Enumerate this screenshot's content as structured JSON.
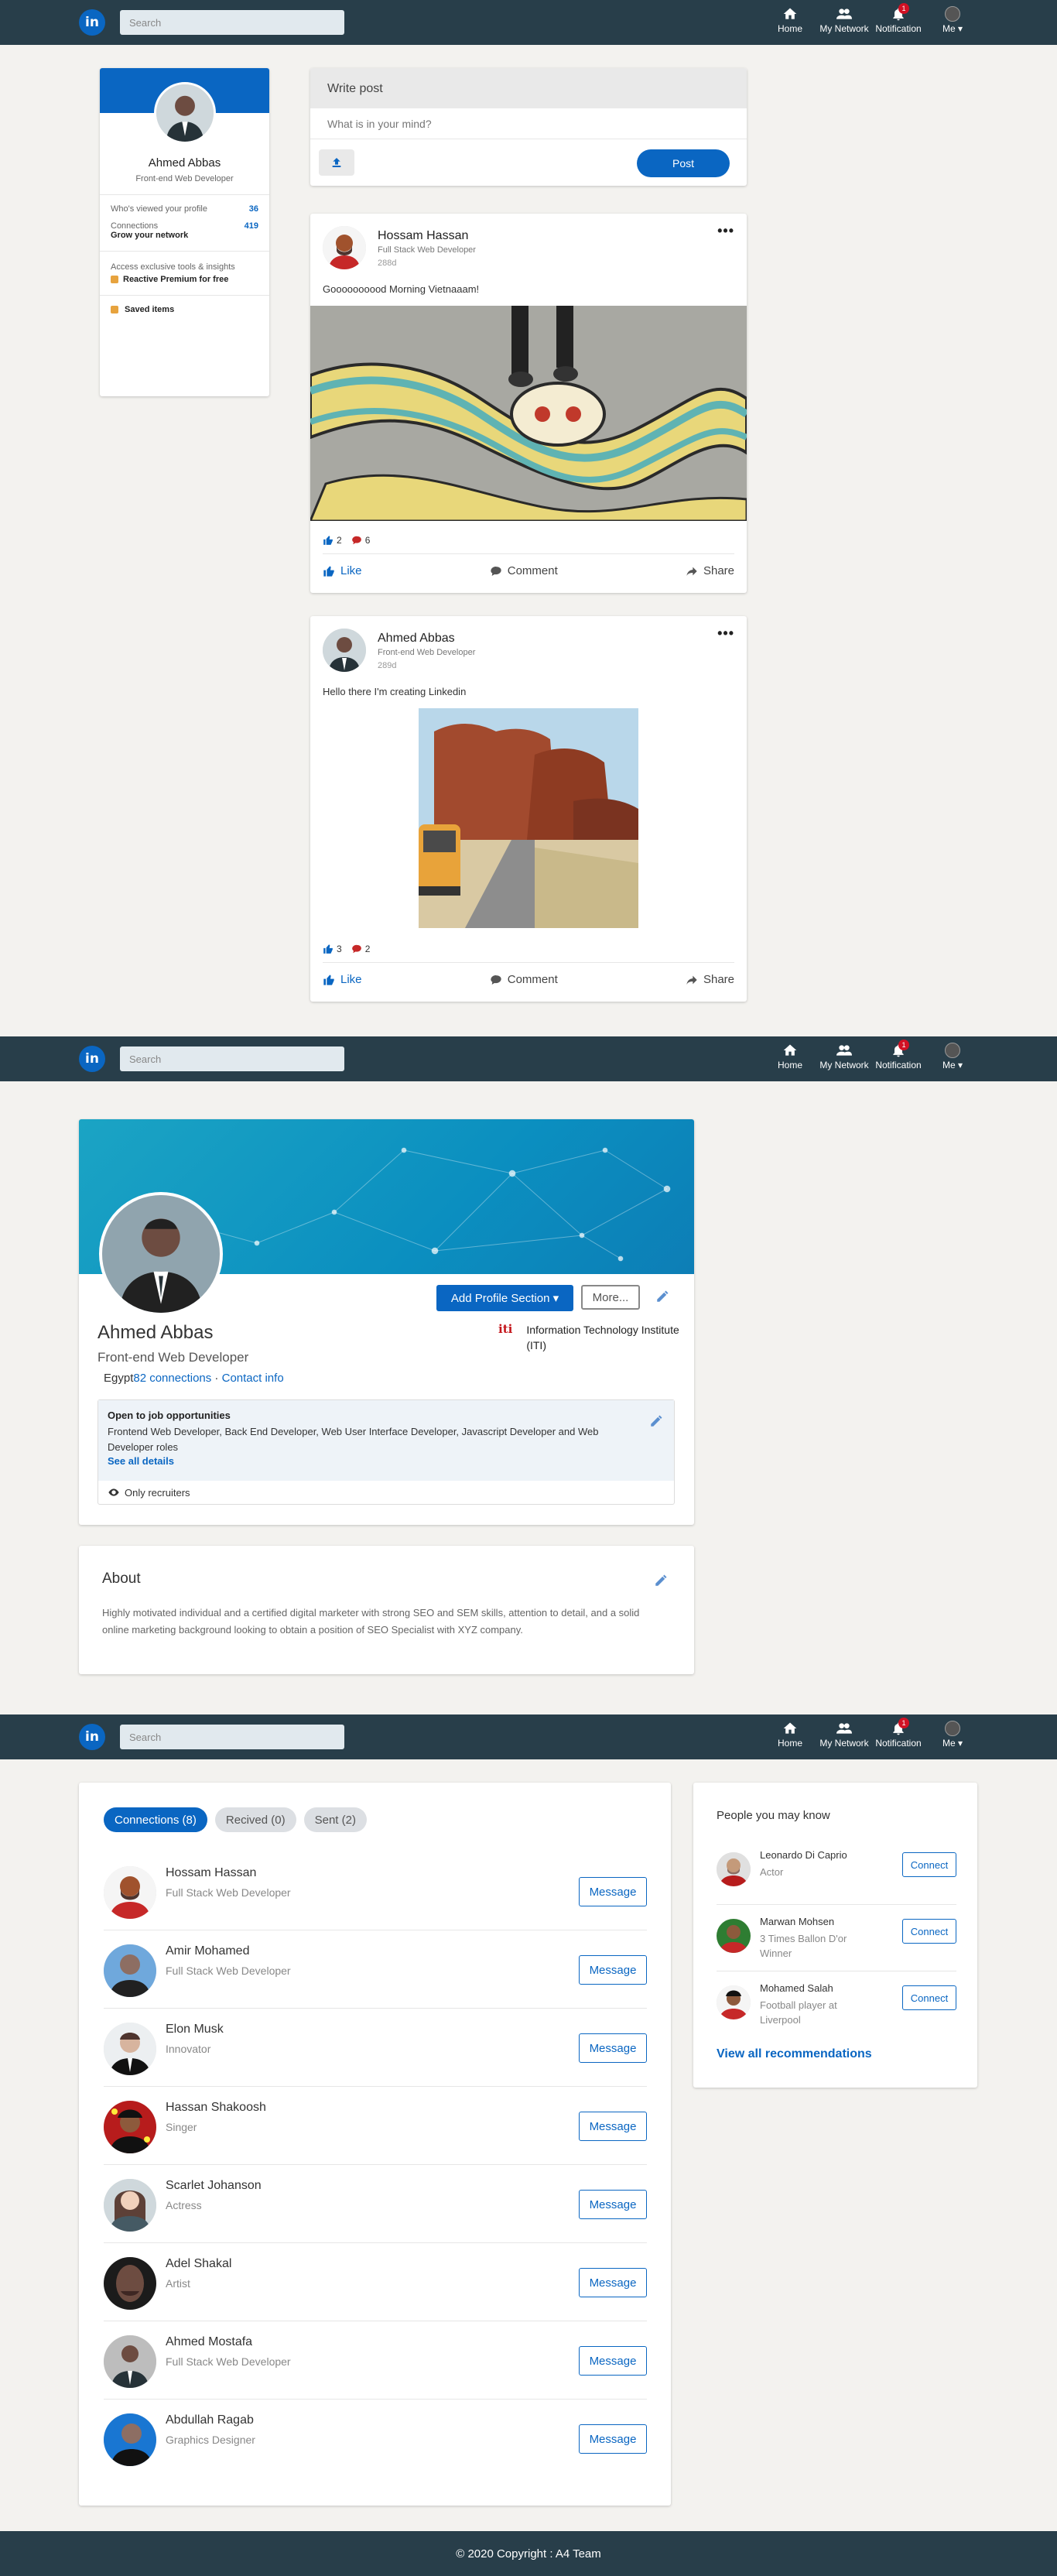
{
  "nav": {
    "logo": "in",
    "search_placeholder": "Search",
    "items": [
      {
        "label": "Home",
        "icon": "home-icon"
      },
      {
        "label": "My Network",
        "icon": "people-icon"
      },
      {
        "label": "Notification",
        "icon": "bell-icon",
        "badge": "1"
      },
      {
        "label": "Me",
        "icon": "avatar"
      }
    ]
  },
  "profile_card": {
    "name": "Ahmed Abbas",
    "title": "Front-end Web Developer",
    "viewed_label": "Who's viewed your profile",
    "viewed_count": "36",
    "connections_label": "Connections",
    "connections_count": "419",
    "grow_label": "Grow your network",
    "premium_text": "Access exclusive tools & insights",
    "premium_link": "Reactive Premium for free",
    "saved_label": "Saved items"
  },
  "write_post": {
    "title": "Write post",
    "placeholder": "What is in your mind?",
    "post_button": "Post"
  },
  "posts": [
    {
      "name": "Hossam Hassan",
      "title": "Full Stack Web Developer",
      "time": "288d",
      "text": "Goooooooood Morning Vietnaaam!",
      "likes": "2",
      "comments": "6"
    },
    {
      "name": "Ahmed Abbas",
      "title": "Front-end Web Developer",
      "time": "289d",
      "text": "Hello there I'm creating Linkedin",
      "likes": "3",
      "comments": "2"
    }
  ],
  "post_actions": {
    "like": "Like",
    "comment": "Comment",
    "share": "Share"
  },
  "profile": {
    "name": "Ahmed Abbas",
    "title": "Front-end Web Developer",
    "location": "Egypt",
    "connections": "82 connections",
    "separator": " · ",
    "contact": "Contact info",
    "add_section": "Add Profile Section",
    "more": "More...",
    "company_logo": "iti",
    "company": "Information Technology Institute (ITI)",
    "opp_heading": "Open to job opportunities",
    "opp_desc": "Frontend Web Developer, Back End Developer, Web User Interface Developer, Javascript Developer and Web Developer roles",
    "opp_see_all": "See all details",
    "opp_visibility": "Only recruiters"
  },
  "about": {
    "heading": "About",
    "text": "Highly motivated individual and a certified digital marketer with strong SEO and SEM skills, attention to detail, and a solid online marketing background looking to obtain a position of SEO Specialist with XYZ company."
  },
  "connections": {
    "tabs": [
      "Connections (8)",
      "Recived (0)",
      "Sent (2)"
    ],
    "message_label": "Message",
    "list": [
      {
        "name": "Hossam Hassan",
        "role": "Full Stack Web Developer"
      },
      {
        "name": "Amir Mohamed",
        "role": "Full Stack Web Developer"
      },
      {
        "name": "Elon Musk",
        "role": "Innovator"
      },
      {
        "name": "Hassan Shakoosh",
        "role": "Singer"
      },
      {
        "name": "Scarlet Johanson",
        "role": "Actress"
      },
      {
        "name": "Adel Shakal",
        "role": "Artist"
      },
      {
        "name": "Ahmed Mostafa",
        "role": "Full Stack Web Developer"
      },
      {
        "name": "Abdullah Ragab",
        "role": "Graphics Designer"
      }
    ]
  },
  "pymk": {
    "heading": "People you may know",
    "connect_label": "Connect",
    "view_all": "View all recommendations",
    "list": [
      {
        "name": "Leonardo Di Caprio",
        "role": "Actor"
      },
      {
        "name": "Marwan Mohsen",
        "role": "3 Times Ballon D'or Winner"
      },
      {
        "name": "Mohamed Salah",
        "role": "Football player at Liverpool"
      }
    ]
  },
  "footer": {
    "text": "© 2020 Copyright : A4 Team"
  },
  "colors": {
    "brand": "#0a66c2",
    "nav": "#283e4a",
    "badge": "#d11124",
    "background": "#f3f2ef"
  }
}
